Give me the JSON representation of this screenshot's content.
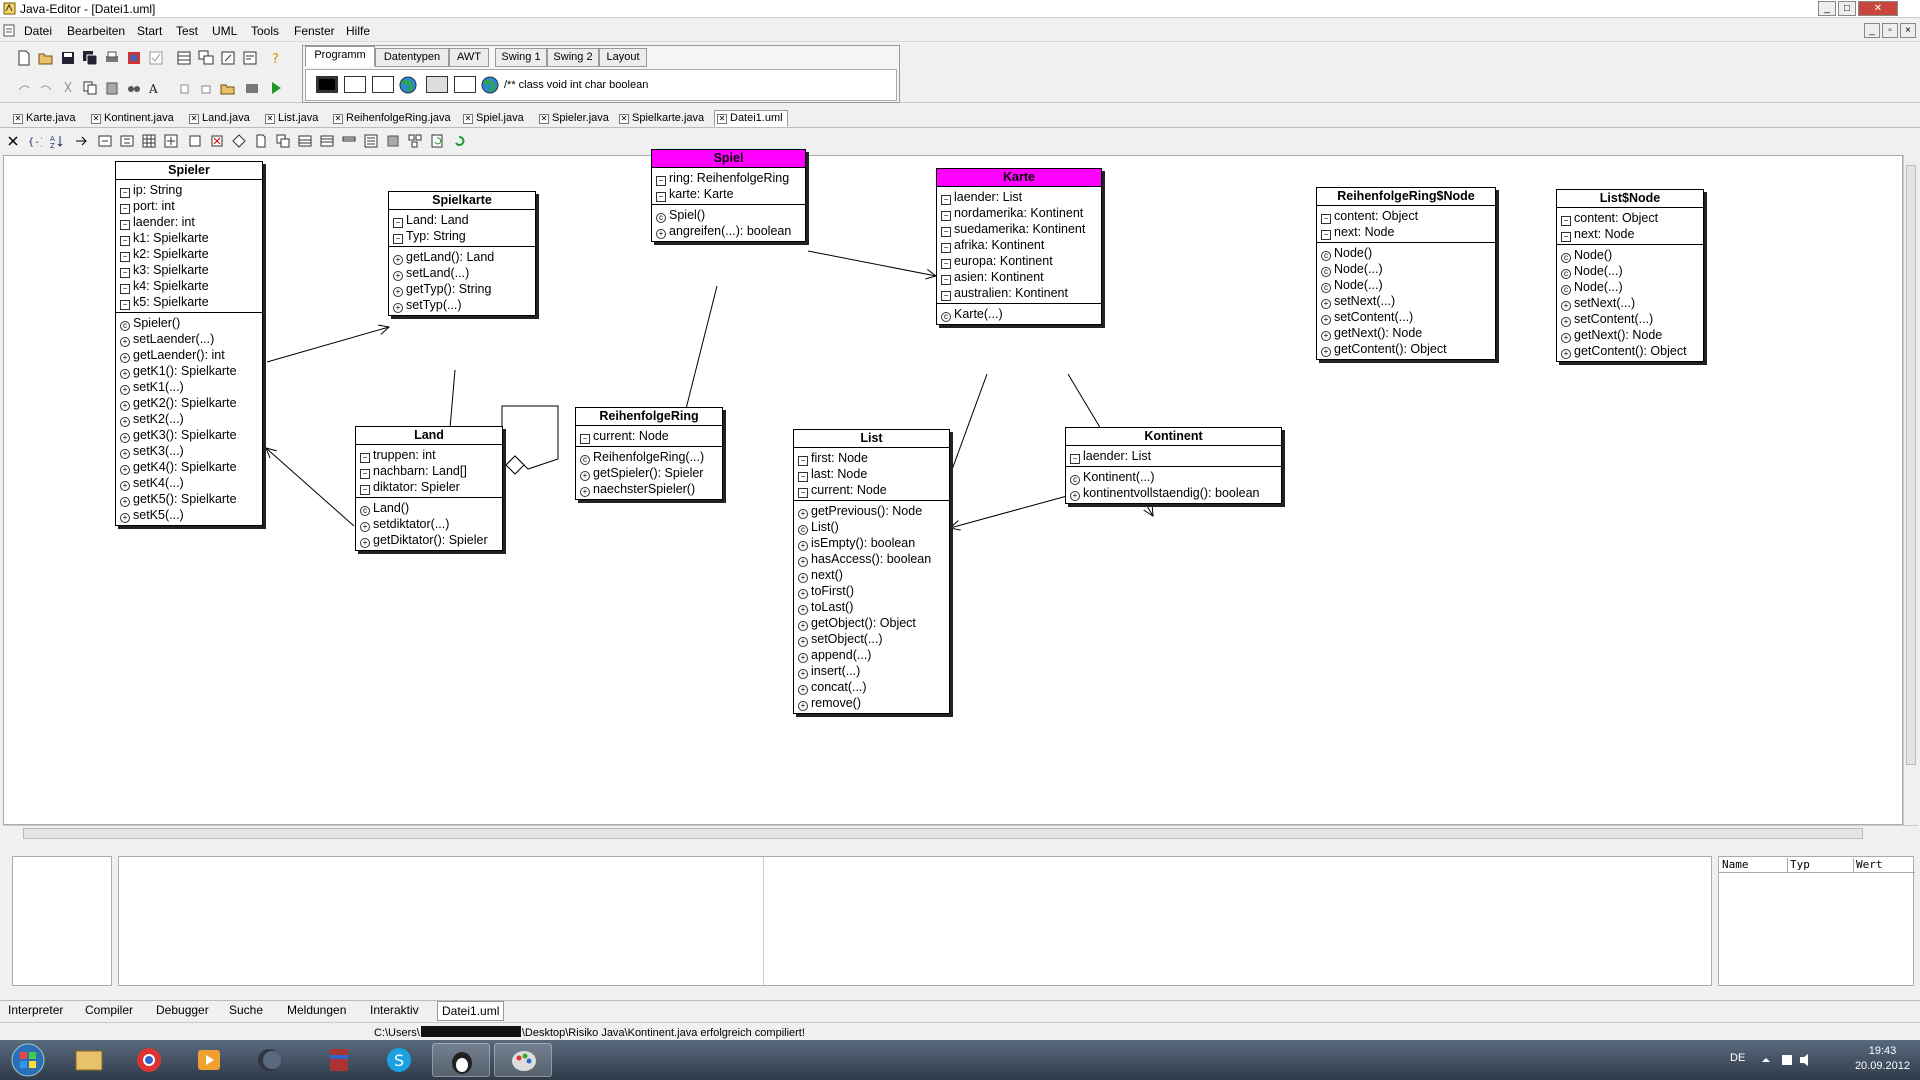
{
  "window": {
    "title": "Java-Editor - [Datei1.uml]",
    "controls": [
      "_",
      "□",
      "✕"
    ]
  },
  "menu": [
    "Datei",
    "Bearbeiten",
    "Start",
    "Test",
    "UML",
    "Tools",
    "Fenster",
    "Hilfe"
  ],
  "palette": {
    "tabs": [
      "Programm",
      "Datentypen",
      "AWT",
      "Swing 1",
      "Swing 2",
      "Layout"
    ],
    "active_tab": "Programm",
    "keywords": "/** class void int char boolean"
  },
  "file_tabs": [
    "Karte.java",
    "Kontinent.java",
    "Land.java",
    "List.java",
    "ReihenfolgeRing.java",
    "Spiel.java",
    "Spieler.java",
    "Spielkarte.java",
    "Datei1.uml"
  ],
  "active_file": "Datei1.uml",
  "classes": {
    "spieler": {
      "name": "Spieler",
      "attributes": [
        "ip: String",
        "port: int",
        "laender: int",
        "k1: Spielkarte",
        "k2: Spielkarte",
        "k3: Spielkarte",
        "k4: Spielkarte",
        "k5: Spielkarte"
      ],
      "methods": [
        "Spieler()",
        "setLaender(...)",
        "getLaender(): int",
        "getK1(): Spielkarte",
        "setK1(...)",
        "getK2(): Spielkarte",
        "setK2(...)",
        "getK3(): Spielkarte",
        "setK3(...)",
        "getK4(): Spielkarte",
        "setK4(...)",
        "getK5(): Spielkarte",
        "setK5(...)"
      ]
    },
    "spielkarte": {
      "name": "Spielkarte",
      "attributes": [
        "Land: Land",
        "Typ: String"
      ],
      "methods": [
        "getLand(): Land",
        "setLand(...)",
        "getTyp(): String",
        "setTyp(...)"
      ]
    },
    "spiel": {
      "name": "Spiel",
      "attributes": [
        "ring: ReihenfolgeRing",
        "karte: Karte"
      ],
      "methods": [
        "Spiel()",
        "angreifen(...): boolean"
      ]
    },
    "karte": {
      "name": "Karte",
      "attributes": [
        "laender: List",
        "nordamerika: Kontinent",
        "suedamerika: Kontinent",
        "afrika: Kontinent",
        "europa: Kontinent",
        "asien: Kontinent",
        "australien: Kontinent"
      ],
      "methods": [
        "Karte(...)"
      ]
    },
    "ringnode": {
      "name": "ReihenfolgeRing$Node",
      "attributes": [
        "content: Object",
        "next: Node"
      ],
      "methods": [
        "Node()",
        "Node(...)",
        "Node(...)",
        "setNext(...)",
        "setContent(...)",
        "getNext(): Node",
        "getContent(): Object"
      ]
    },
    "listnode": {
      "name": "List$Node",
      "attributes": [
        "content: Object",
        "next: Node"
      ],
      "methods": [
        "Node()",
        "Node(...)",
        "Node(...)",
        "setNext(...)",
        "setContent(...)",
        "getNext(): Node",
        "getContent(): Object"
      ]
    },
    "land": {
      "name": "Land",
      "attributes": [
        "truppen: int",
        "nachbarn: Land[]",
        "diktator: Spieler"
      ],
      "methods": [
        "Land()",
        "setdiktator(...)",
        "getDiktator(): Spieler"
      ]
    },
    "ring": {
      "name": "ReihenfolgeRing",
      "attributes": [
        "current: Node"
      ],
      "methods": [
        "ReihenfolgeRing(...)",
        "getSpieler(): Spieler",
        "naechsterSpieler()"
      ]
    },
    "list": {
      "name": "List",
      "attributes": [
        "first: Node",
        "last: Node",
        "current: Node"
      ],
      "methods": [
        "getPrevious(): Node",
        "List()",
        "isEmpty(): boolean",
        "hasAccess(): boolean",
        "next()",
        "toFirst()",
        "toLast()",
        "getObject(): Object",
        "setObject(...)",
        "append(...)",
        "insert(...)",
        "concat(...)",
        "remove()"
      ]
    },
    "kontinent": {
      "name": "Kontinent",
      "attributes": [
        "laender: List"
      ],
      "methods": [
        "Kontinent(...)",
        "kontinentvollstaendig(): boolean"
      ]
    }
  },
  "watch_columns": [
    "Name",
    "Typ",
    "Wert"
  ],
  "bottom_tabs": [
    "Interpreter",
    "Compiler",
    "Debugger",
    "Suche",
    "Meldungen",
    "Interaktiv",
    "Datei1.uml"
  ],
  "active_bottom_tab": "Datei1.uml",
  "status": {
    "prefix": "C:\\Users\\",
    "suffix": "\\Desktop\\Risiko Java\\Kontinent.java erfolgreich compiliert!"
  },
  "taskbar": {
    "language": "DE",
    "time": "19:43",
    "date": "20.09.2012"
  }
}
